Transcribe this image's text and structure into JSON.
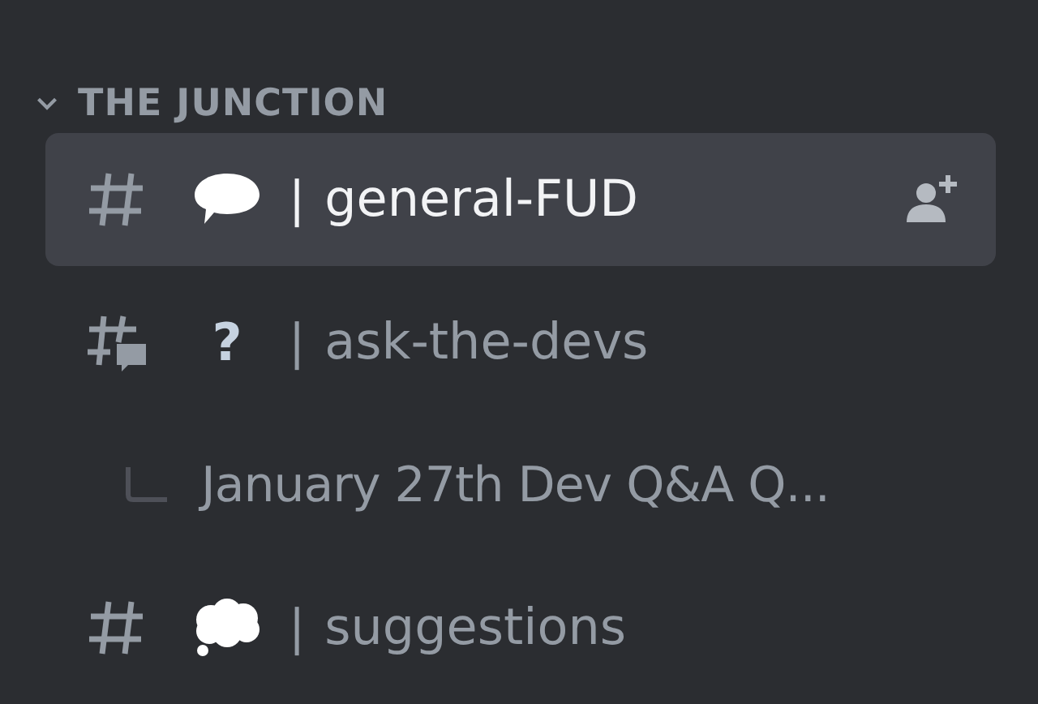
{
  "category": {
    "name": "THE JUNCTION",
    "expanded": true
  },
  "channels": [
    {
      "kind": "text",
      "emoji": {
        "kind": "speech"
      },
      "separator": "|",
      "name": "general-FUD",
      "selected": true,
      "invite": true
    },
    {
      "kind": "forum",
      "emoji": {
        "kind": "glyph",
        "text": "?"
      },
      "separator": "|",
      "name": "ask-the-devs",
      "selected": false,
      "invite": false
    },
    {
      "kind": "thread",
      "name": "January 27th Dev Q&A Q...",
      "selected": false
    },
    {
      "kind": "text",
      "emoji": {
        "kind": "thought"
      },
      "separator": "|",
      "name": "suggestions",
      "selected": false,
      "invite": false
    }
  ]
}
